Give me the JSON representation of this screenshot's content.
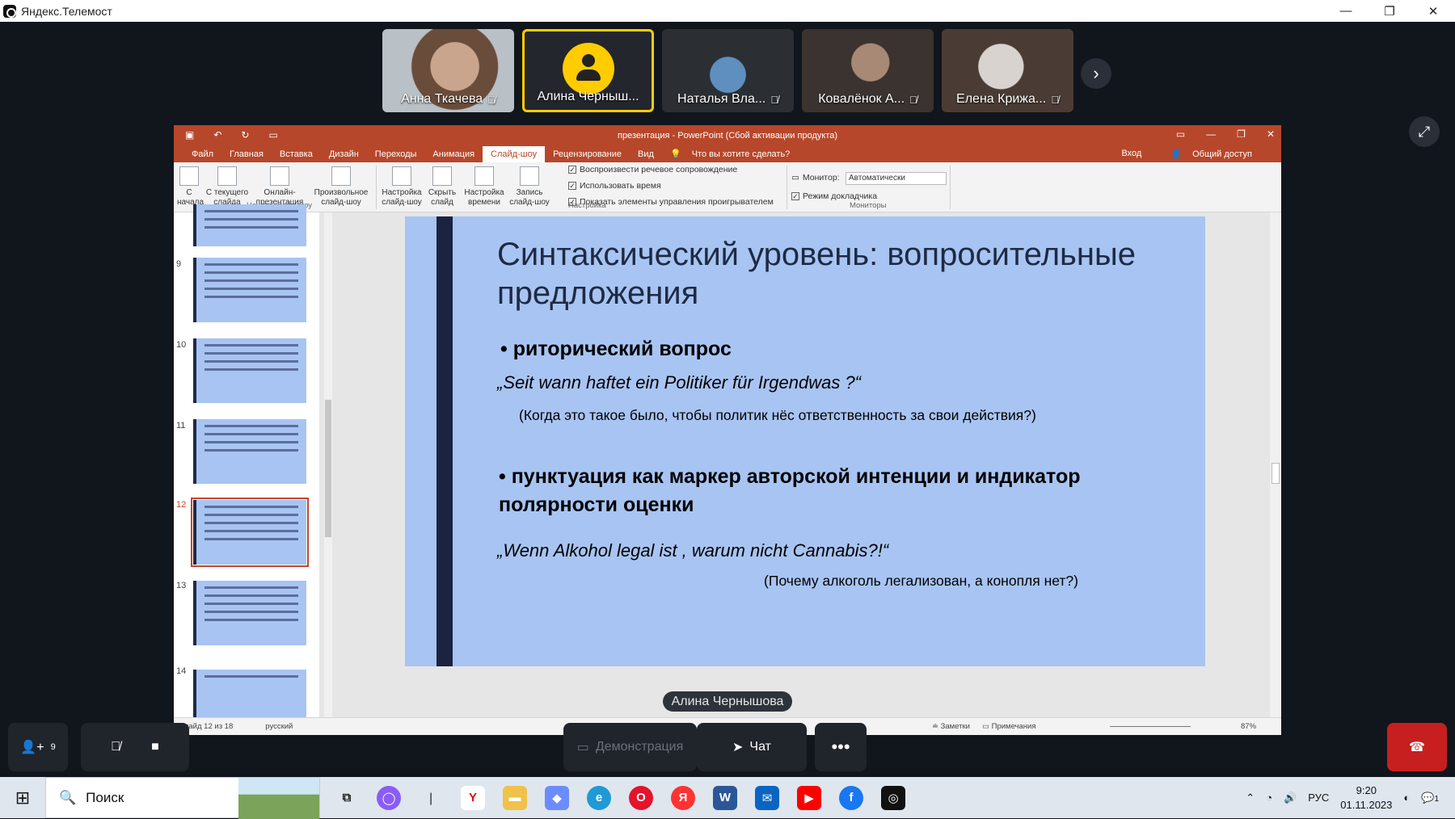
{
  "app": {
    "title": "Яндекс.Телемост"
  },
  "participants": [
    {
      "name": "Анна Ткачева"
    },
    {
      "name": "Алина Черныш..."
    },
    {
      "name": "Наталья Вла..."
    },
    {
      "name": "Ковалёнок А..."
    },
    {
      "name": "Елена Крижа..."
    }
  ],
  "powerpoint": {
    "window_title": "презентация - PowerPoint (Сбой активации продукта)",
    "tabs": [
      "Файл",
      "Главная",
      "Вставка",
      "Дизайн",
      "Переходы",
      "Анимация",
      "Слайд-шоу",
      "Рецензирование",
      "Вид"
    ],
    "active_tab": "Слайд-шоу",
    "tell_me": "Что вы хотите сделать?",
    "sign_in": "Вход",
    "share": "Общий доступ",
    "ribbon": {
      "from_start": "С начала",
      "from_current": "С текущего слайда",
      "online": "Онлайн-презентация",
      "custom": "Произвольное слайд-шоу",
      "group_start": "Начать слайд-шоу",
      "setup": "Настройка слайд-шоу",
      "hide": "Скрыть слайд",
      "rehearse": "Настройка времени",
      "record": "Запись слайд-шоу",
      "chk_narration": "Воспроизвести речевое сопровождение",
      "chk_timings": "Использовать время",
      "chk_controls": "Показать элементы управления проигрывателем",
      "group_setup": "Настройка",
      "monitor_label": "Монитор:",
      "monitor_value": "Автоматически",
      "presenter_view": "Режим докладчика",
      "group_monitors": "Мониторы"
    },
    "thumbnails": [
      {
        "num": "9"
      },
      {
        "num": "10"
      },
      {
        "num": "11"
      },
      {
        "num": "12"
      },
      {
        "num": "13"
      },
      {
        "num": "14"
      }
    ],
    "slide": {
      "title": "Синтаксический уровень: вопросительные предложения",
      "bullet1": "• риторический вопрос",
      "quote1": "„Seit wann haftet ein Politiker für Irgendwas ?“",
      "translation1": "(Когда это такое было, чтобы политик нёс ответственность за свои действия?)",
      "bullet2": "• пунктуация как маркер авторской интенции и индикатор полярности оценки",
      "quote2": "„Wenn Alkohol legal ist , warum nicht Cannabis?!“",
      "translation2": "(Почему алкоголь легализован, а конопля нет?)"
    },
    "status": {
      "slide": "Слайд 12 из 18",
      "language": "русский",
      "notes": "Заметки",
      "comments": "Примечания",
      "zoom": "87%"
    }
  },
  "presenter": "Алина Чернышова",
  "controls": {
    "participants_count": "9",
    "demo": "Демонстрация",
    "chat": "Чат"
  },
  "taskbar": {
    "search": "Поиск",
    "lang": "РУС",
    "time": "9:20",
    "date": "01.11.2023",
    "notif": "1"
  }
}
